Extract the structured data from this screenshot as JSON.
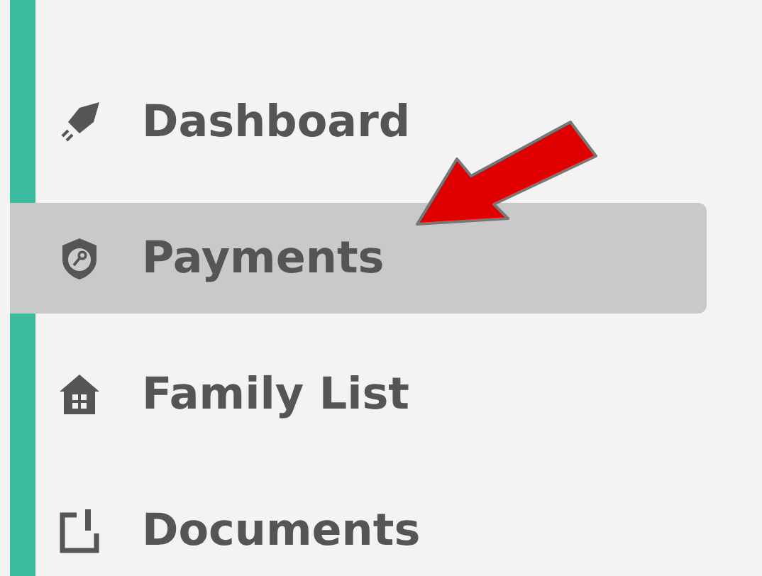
{
  "sidebar": {
    "items": [
      {
        "label": "Dashboard",
        "kind": "rocket",
        "selected": false
      },
      {
        "label": "Payments",
        "kind": "shield",
        "selected": true
      },
      {
        "label": "Family List",
        "kind": "house",
        "selected": false
      },
      {
        "label": "Documents",
        "kind": "document",
        "selected": false
      }
    ]
  },
  "annotations": [
    {
      "kind": "arrow"
    }
  ]
}
